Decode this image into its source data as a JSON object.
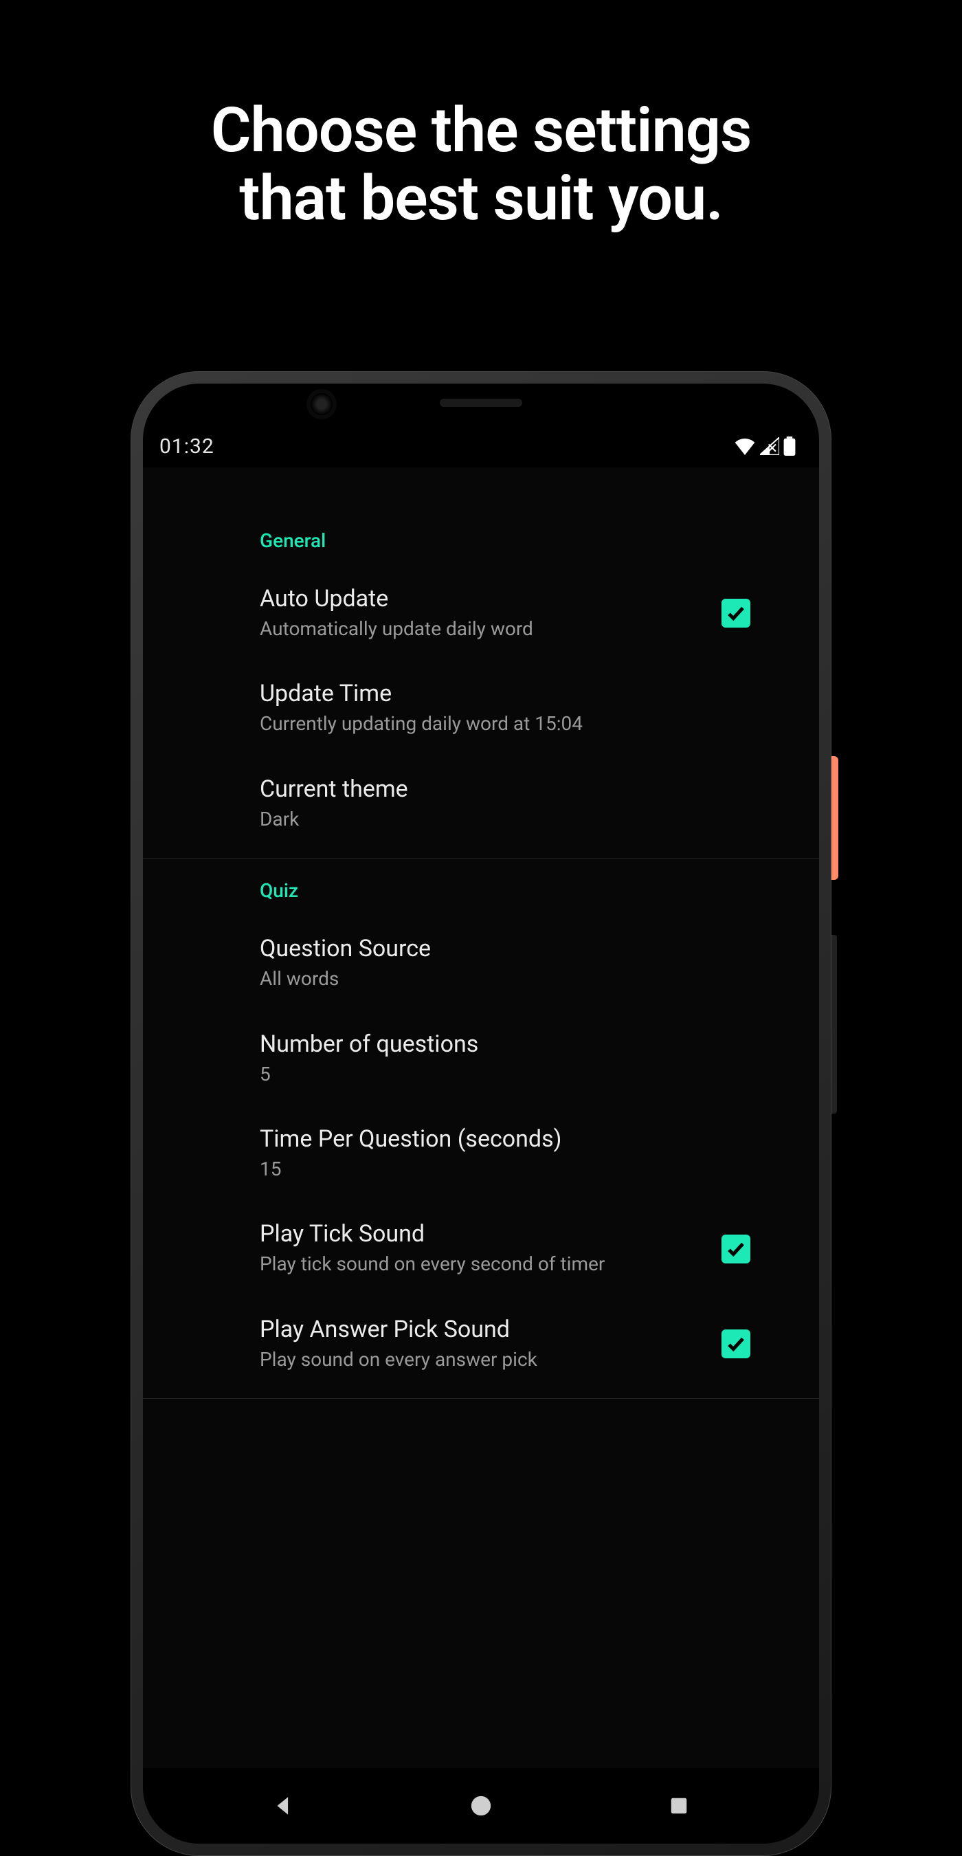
{
  "promo": {
    "line1": "Choose the settings",
    "line2": "that best suit you."
  },
  "statusbar": {
    "time": "01:32"
  },
  "sections": {
    "general": {
      "header": "General",
      "auto_update": {
        "title": "Auto Update",
        "sub": "Automatically update daily word",
        "checked": true
      },
      "update_time": {
        "title": "Update Time",
        "sub": "Currently updating daily word at 15:04"
      },
      "theme": {
        "title": "Current theme",
        "sub": "Dark"
      }
    },
    "quiz": {
      "header": "Quiz",
      "question_source": {
        "title": "Question Source",
        "sub": "All words"
      },
      "num_questions": {
        "title": "Number of questions",
        "sub": "5"
      },
      "time_per_question": {
        "title": "Time Per Question (seconds)",
        "sub": "15"
      },
      "play_tick": {
        "title": "Play Tick Sound",
        "sub": "Play tick sound on every second of timer",
        "checked": true
      },
      "play_answer": {
        "title": "Play Answer Pick Sound",
        "sub": "Play sound on every answer pick",
        "checked": true
      }
    }
  }
}
